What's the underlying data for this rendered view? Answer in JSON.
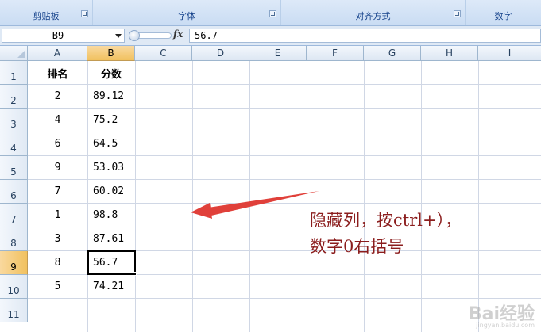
{
  "ribbon": {
    "groups": [
      "剪贴板",
      "字体",
      "对齐方式",
      "数字"
    ]
  },
  "formula_bar": {
    "name_box": "B9",
    "fx_label": "fx",
    "formula": "56.7"
  },
  "columns": [
    "A",
    "B",
    "C",
    "D",
    "E",
    "F",
    "G",
    "H",
    "I"
  ],
  "rows": [
    "1",
    "2",
    "3",
    "4",
    "5",
    "6",
    "7",
    "8",
    "9",
    "10",
    "11"
  ],
  "table": {
    "headers": [
      "排名",
      "分数"
    ],
    "data": [
      [
        "2",
        "89.12"
      ],
      [
        "4",
        "75.2"
      ],
      [
        "6",
        "64.5"
      ],
      [
        "9",
        "53.03"
      ],
      [
        "7",
        "60.02"
      ],
      [
        "1",
        "98.8"
      ],
      [
        "3",
        "87.61"
      ],
      [
        "8",
        "56.7"
      ],
      [
        "5",
        "74.21"
      ]
    ]
  },
  "selection": {
    "cell": "B9",
    "column": "B",
    "row": "9"
  },
  "annotation": {
    "line1": "隐藏列，按ctrl+），",
    "line2": "数字0右括号",
    "color": "#8b1d1d"
  },
  "watermark": {
    "text": "Bai经验",
    "sub": "jingyan.baidu.com"
  }
}
